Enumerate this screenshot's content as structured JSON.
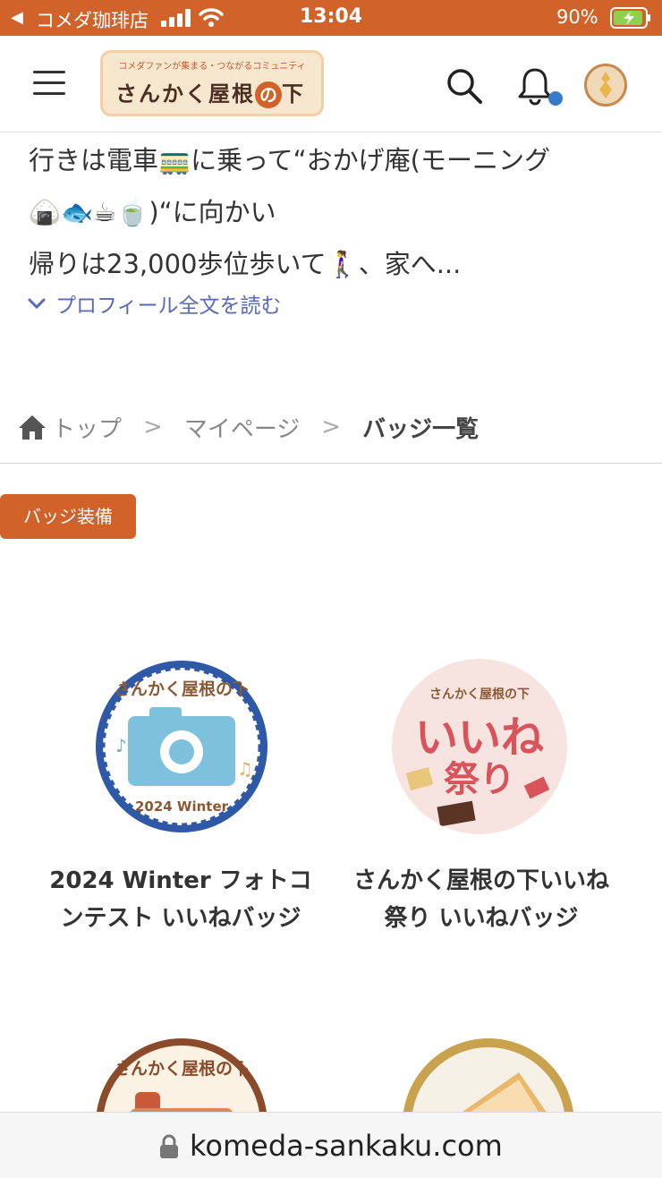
{
  "status_bar": {
    "carrier": "コメダ珈琲店",
    "time": "13:04",
    "battery": "90%"
  },
  "header": {
    "logo_sub": "コメダファンが集まる・つながるコミュニティ",
    "logo_main_a": "さんかく屋根",
    "logo_main_no": "の",
    "logo_main_b": "下"
  },
  "profile": {
    "line1": "行きは電車🚃に乗って“おかげ庵(モーニング",
    "line2": "🍙🐟☕🍵)“に向かい",
    "line3": "帰りは23,000歩位歩いて🚶‍♀️、家へ...",
    "read_more": "プロフィール全文を読む"
  },
  "breadcrumb": {
    "home": "トップ",
    "sep": ">",
    "mypage": "マイページ",
    "current": "バッジ一覧"
  },
  "equip_button": "バッジ装備",
  "badges": [
    {
      "title": "2024 Winter フォトコンテスト いいねバッジ",
      "title_line1": "2024 Winter フォトコ",
      "title_line2": "ンテスト いいねバッジ",
      "art_top": "さんかく屋根の下",
      "art_bottom": "2024 Winter"
    },
    {
      "title": "さんかく屋根の下いいね祭り いいねバッジ",
      "title_line1": "さんかく屋根の下いいね",
      "title_line2": "祭り いいねバッジ",
      "art_top": "さんかく屋根の下",
      "art_main": "いいね",
      "art_sub": "祭り"
    },
    {
      "art_top": "さんかく屋根の下"
    },
    {}
  ],
  "url_bar": {
    "url": "komeda-sankaku.com"
  },
  "colors": {
    "accent": "#d0622a",
    "link": "#5b6ab5",
    "notification": "#3a7bc8"
  }
}
